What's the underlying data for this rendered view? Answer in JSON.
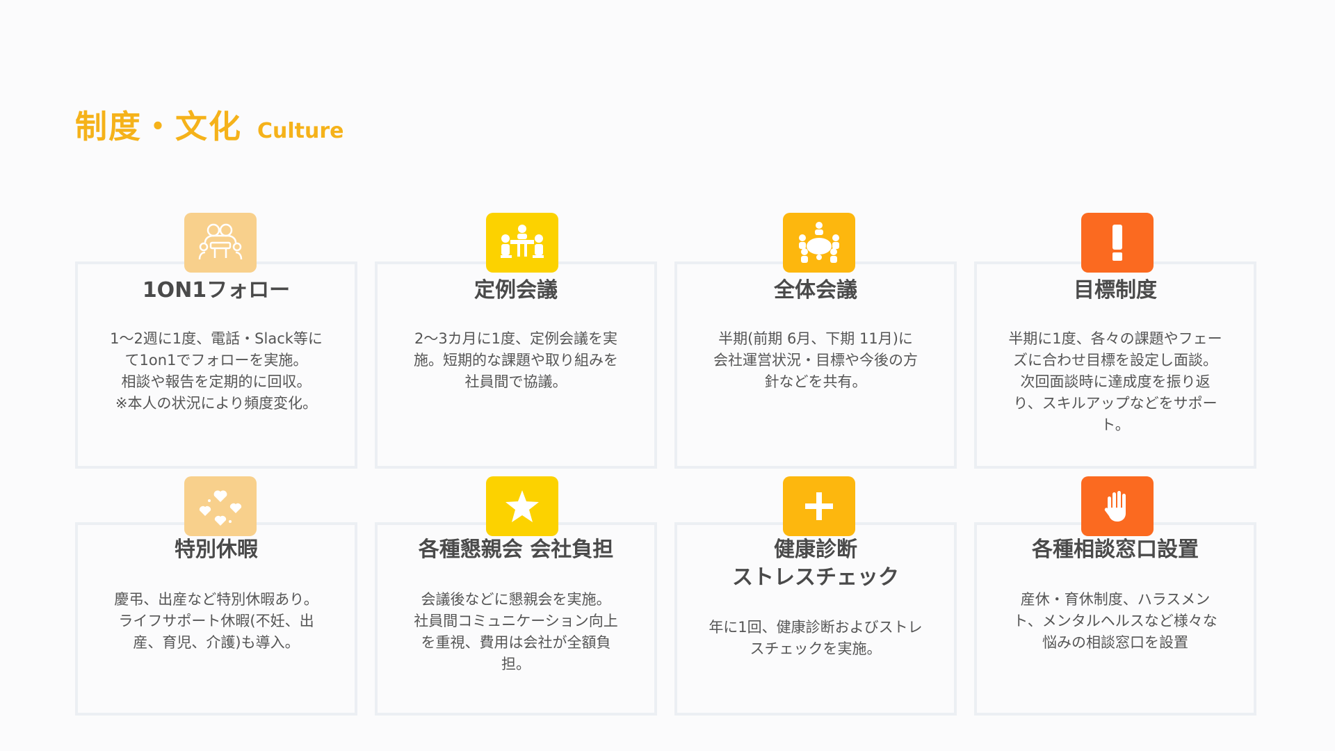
{
  "header": {
    "title_ja": "制度・文化",
    "title_en": "Culture"
  },
  "cards": [
    {
      "title": "1ON1フォロー",
      "desc": [
        "1〜2週に1度、電話・Slack等に",
        "て1on1でフォローを実施。",
        "相談や報告を定期的に回収。",
        "※本人の状況により頻度変化。"
      ],
      "icon": "one-on-one-icon",
      "color": "#f8d08c"
    },
    {
      "title": "定例会議",
      "desc": [
        "2〜3カ月に1度、定例会議を実",
        "施。短期的な課題や取り組みを",
        "社員間で協議。"
      ],
      "icon": "meeting-table-icon",
      "color": "#fcd200"
    },
    {
      "title": "全体会議",
      "desc": [
        "半期(前期 6月、下期 11月)に",
        "会社運営状況・目標や今後の方",
        "針などを共有。"
      ],
      "icon": "all-hands-meeting-icon",
      "color": "#fdb70e"
    },
    {
      "title": "目標制度",
      "desc": [
        "半期に1度、各々の課題やフェー",
        "ズに合わせ目標を設定し面談。",
        "次回面談時に達成度を振り返",
        "り、スキルアップなどをサポー",
        "ト。"
      ],
      "icon": "exclamation-icon",
      "color": "#fb6a20"
    },
    {
      "title": "特別休暇",
      "desc": [
        "慶弔、出産など特別休暇あり。",
        "ライフサポート休暇(不妊、出",
        "産、育児、介護)も導入。"
      ],
      "icon": "hearts-icon",
      "color": "#f8d08c"
    },
    {
      "title": "各種懇親会 会社負担",
      "desc": [
        "会議後などに懇親会を実施。",
        "社員間コミュニケーション向上",
        "を重視、費用は会社が全額負",
        "担。"
      ],
      "icon": "star-icon",
      "color": "#fcd200"
    },
    {
      "title_lines": [
        "健康診断",
        "ストレスチェック"
      ],
      "desc": [
        "年に1回、健康診断およびストレ",
        "スチェックを実施。"
      ],
      "icon": "plus-icon",
      "color": "#fdb70e"
    },
    {
      "title": "各種相談窓口設置",
      "desc": [
        "産休・育休制度、ハラスメン",
        "ト、メンタルヘルスなど様々な",
        "悩みの相談窓口を設置"
      ],
      "icon": "hand-icon",
      "color": "#fb6a20"
    }
  ]
}
